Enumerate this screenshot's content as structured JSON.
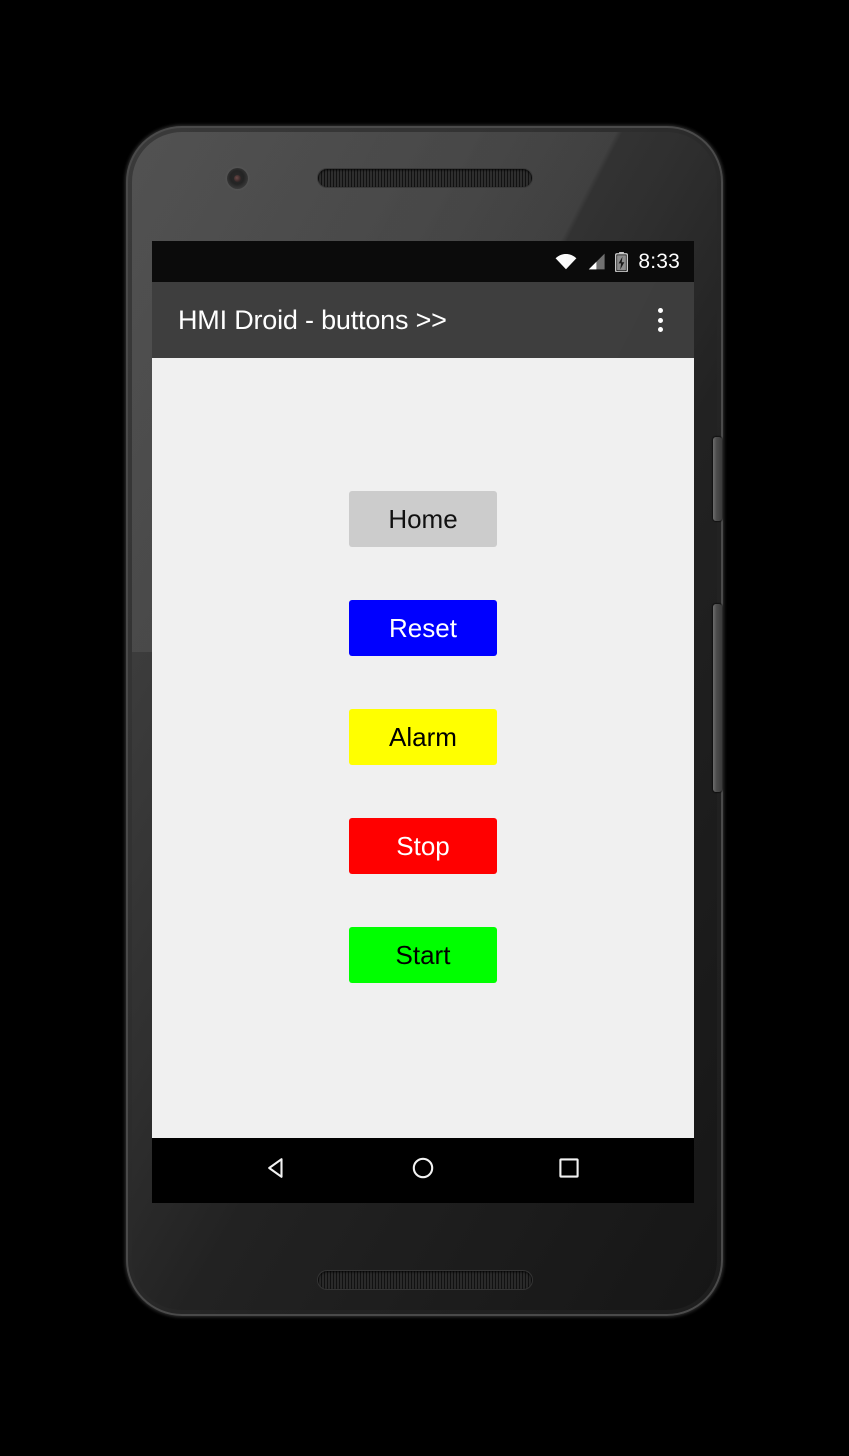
{
  "device": {
    "name": "android-phone",
    "frame_color": "#2e2e2e",
    "camera_icon": "front-camera-icon",
    "earpiece_icon": "earpiece-speaker-grille-icon",
    "bottom_speaker_icon": "bottom-speaker-grille-icon",
    "power_button_label": "Power",
    "volume_button_label": "Volume"
  },
  "status_bar": {
    "background": "#0b0b0b",
    "wifi_icon": "wifi-icon",
    "signal_icon": "cellular-signal-icon",
    "battery_icon": "battery-charging-icon",
    "clock": "8:33"
  },
  "app_bar": {
    "title": "HMI Droid - buttons >>",
    "background": "#333333",
    "text_color": "#ffffff",
    "overflow_icon": "overflow-menu-icon"
  },
  "content": {
    "background": "#f0f0f0",
    "buttons": [
      {
        "label": "Home",
        "bg": "#cccccc",
        "fg": "#111111",
        "name": "home"
      },
      {
        "label": "Reset",
        "bg": "#0000ff",
        "fg": "#ffffff",
        "name": "reset"
      },
      {
        "label": "Alarm",
        "bg": "#ffff00",
        "fg": "#000000",
        "name": "alarm"
      },
      {
        "label": "Stop",
        "bg": "#ff0000",
        "fg": "#ffffff",
        "name": "stop"
      },
      {
        "label": "Start",
        "bg": "#00ff00",
        "fg": "#000000",
        "name": "start"
      }
    ]
  },
  "nav_bar": {
    "background": "#000000",
    "items": [
      {
        "label": "Back",
        "icon": "back-triangle-icon"
      },
      {
        "label": "Home",
        "icon": "home-circle-icon"
      },
      {
        "label": "Recents",
        "icon": "recents-square-icon"
      }
    ]
  }
}
